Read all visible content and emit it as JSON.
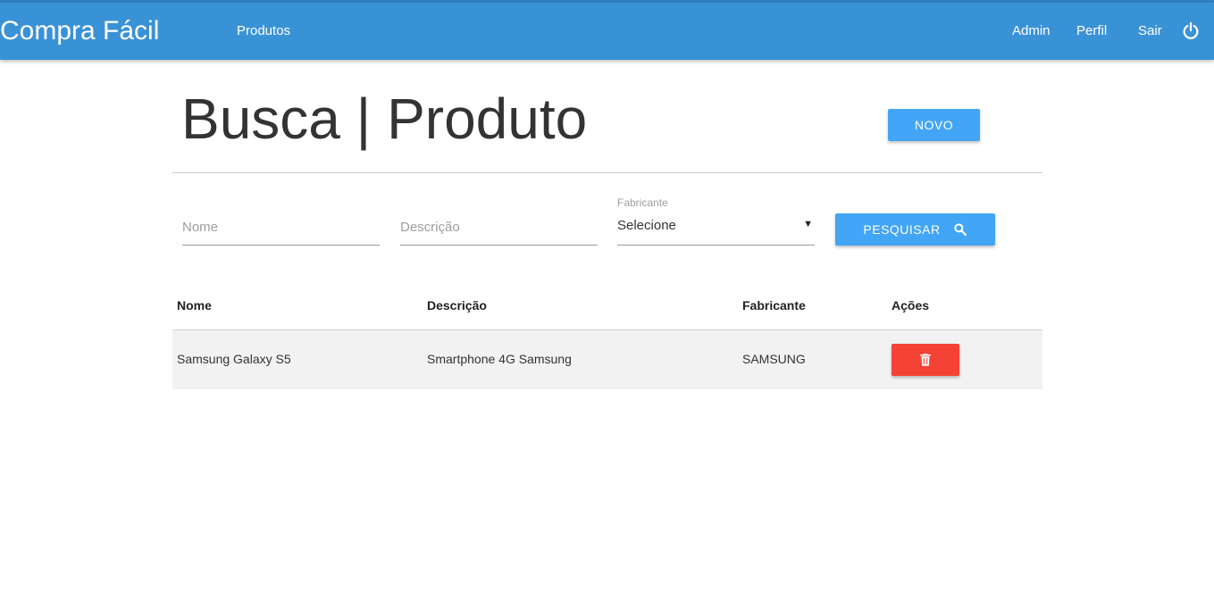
{
  "app": {
    "brand": "Compra Fácil"
  },
  "nav": {
    "products": "Produtos",
    "admin": "Admin",
    "profile": "Perfil",
    "logout": "Sair",
    "logout_icon": "power-icon"
  },
  "page": {
    "title": "Busca | Produto",
    "new_button": "NOVO"
  },
  "filters": {
    "name_placeholder": "Nome",
    "name_value": "",
    "description_placeholder": "Descrição",
    "description_value": "",
    "manufacturer_label": "Fabricante",
    "manufacturer_selected": "Selecione",
    "search_button": "PESQUISAR",
    "search_icon": "search-icon"
  },
  "table": {
    "columns": [
      "Nome",
      "Descrição",
      "Fabricante",
      "Ações"
    ],
    "rows": [
      {
        "name": "Samsung Galaxy S5",
        "description": "Smartphone 4G Samsung",
        "manufacturer": "SAMSUNG",
        "action_icon": "trash-icon"
      }
    ]
  },
  "colors": {
    "navbar": "#3a92d6",
    "primary_button": "#42a5f5",
    "delete_button": "#f44336",
    "row_background": "#f2f2f2"
  }
}
